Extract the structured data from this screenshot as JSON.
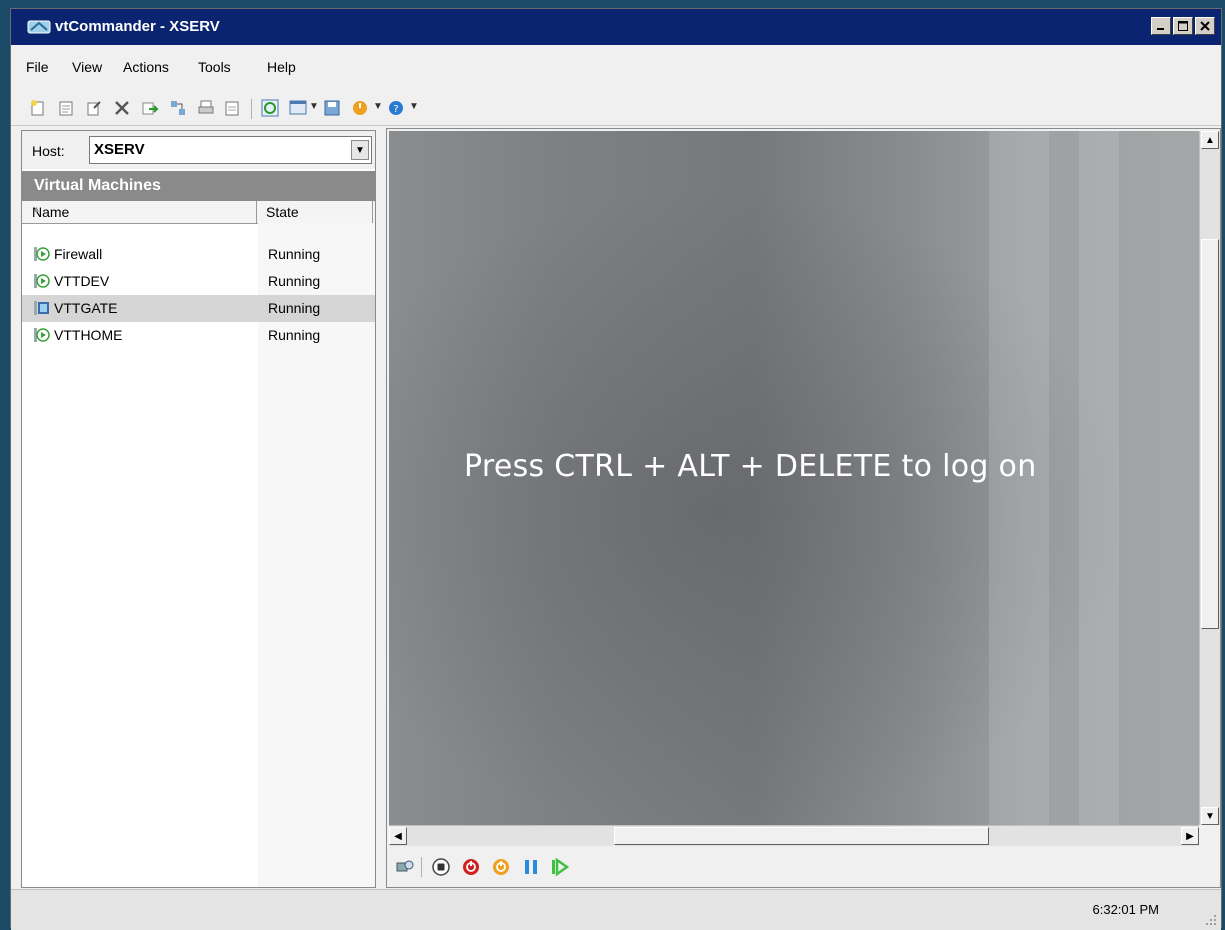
{
  "window": {
    "title": "vtCommander - XSERV",
    "controls": [
      "minimize",
      "maximize",
      "close"
    ]
  },
  "menu": [
    "File",
    "View",
    "Actions",
    "Tools",
    "Help"
  ],
  "host": {
    "label": "Host:",
    "value": "XSERV"
  },
  "vm_panel": {
    "title": "Virtual Machines",
    "columns": [
      "Name",
      "State"
    ],
    "rows": [
      {
        "name": "Firewall",
        "state": "Running",
        "selected": false
      },
      {
        "name": "VTTDEV",
        "state": "Running",
        "selected": false
      },
      {
        "name": "VTTGATE",
        "state": "Running",
        "selected": true
      },
      {
        "name": "VTTHOME",
        "state": "Running",
        "selected": false
      }
    ]
  },
  "console": {
    "message": "Press CTRL + ALT + DELETE to log on"
  },
  "status": {
    "time": "6:32:01 PM"
  },
  "colors": {
    "titlebar": "#0a2472",
    "panel_header": "#8a8a8a",
    "selected_row": "#d5d5d5",
    "stop_red": "#d02020",
    "power_orange": "#f0a020",
    "pause_blue": "#2a8ae0",
    "play_green": "#40c040"
  }
}
